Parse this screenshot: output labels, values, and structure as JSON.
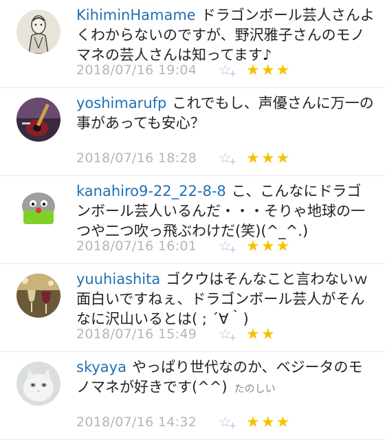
{
  "comments": [
    {
      "username": "KihiminHamame",
      "text": "ドラゴンボール芸人さんよくわからないのですが、野沢雅子さんのモノマネの芸人さんは知ってます♪",
      "tag": "",
      "date": "2018/07/16 19:04",
      "rating": "★★★",
      "avatar": "portrait-drawing"
    },
    {
      "username": "yoshimarufp",
      "text": "これでもし、声優さんに万一の事があっても安心？",
      "tag": "",
      "date": "2018/07/16 18:28",
      "rating": "★★★",
      "avatar": "guitar-photo"
    },
    {
      "username": "kanahiro9-22_22-8-8",
      "text": "こ、こんなにドラゴンボール芸人いるんだ・・・そりゃ地球の一つや二つ吹っ飛ぶわけだ(笑)(^_^.)",
      "tag": "",
      "date": "2018/07/16 16:01",
      "rating": "★★★",
      "avatar": "character-face"
    },
    {
      "username": "yuuhiashita",
      "text": "ゴクウはそんなこと言わないｗ面白いですねぇ、ドラゴンボール芸人がそんなに沢山いるとは( ; ´∀｀)",
      "tag": "",
      "date": "2018/07/16 15:49",
      "rating": "★★",
      "avatar": "wine-glasses-photo"
    },
    {
      "username": "skyaya",
      "text": "やっぱり世代なのか、ベジータのモノマネが好きです(^^)",
      "tag": "たのしい",
      "date": "2018/07/16 14:32",
      "rating": "★★★",
      "avatar": "cat-photo"
    }
  ],
  "fav_icon": {
    "glyph": "☆",
    "plus": "+"
  },
  "colors": {
    "username": "#1f6fb3",
    "date": "#b5b5b5",
    "star": "#f3c200",
    "fav": "#a9bfe2"
  }
}
